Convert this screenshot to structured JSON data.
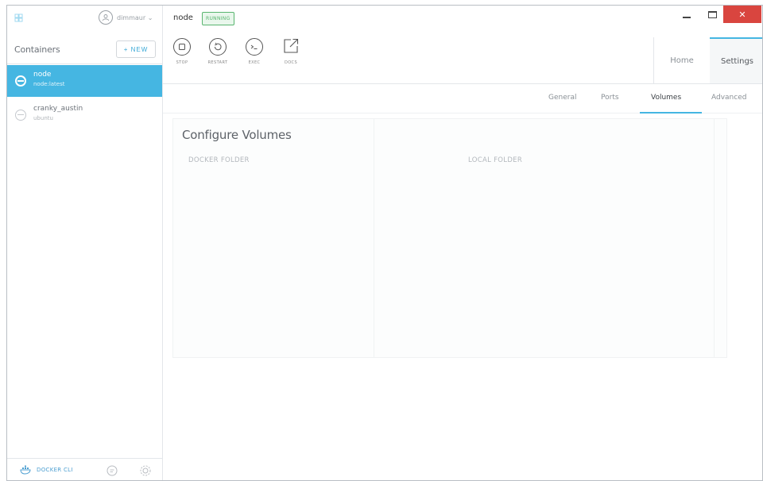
{
  "sidebar": {
    "username": "dimmaur ⌄",
    "title": "Containers",
    "new_label": "+ NEW",
    "containers": [
      {
        "name": "node",
        "image": "node:latest",
        "active": true
      },
      {
        "name": "cranky_austin",
        "image": "ubuntu",
        "active": false
      }
    ],
    "footer_link": "DOCKER CLI"
  },
  "header": {
    "container_name": "node",
    "status": "RUNNING",
    "close_glyph": "✕"
  },
  "toolbar": {
    "stop": "STOP",
    "restart": "RESTART",
    "exec": "EXEC",
    "docs": "DOCS"
  },
  "topnav": {
    "home": "Home",
    "settings": "Settings"
  },
  "subnav": {
    "general": "General",
    "ports": "Ports",
    "volumes": "Volumes",
    "advanced": "Advanced"
  },
  "volumes": {
    "heading": "Configure Volumes",
    "col_docker": "DOCKER FOLDER",
    "col_local": "LOCAL FOLDER"
  },
  "colors": {
    "accent": "#45b6e2",
    "running": "#59b56f",
    "close": "#d9453f"
  },
  "icons": [
    "logo-icon",
    "user-avatar-icon",
    "container-state-icon",
    "stop-icon",
    "restart-icon",
    "exec-icon",
    "docs-icon",
    "whale-icon",
    "chat-icon",
    "gear-icon"
  ]
}
